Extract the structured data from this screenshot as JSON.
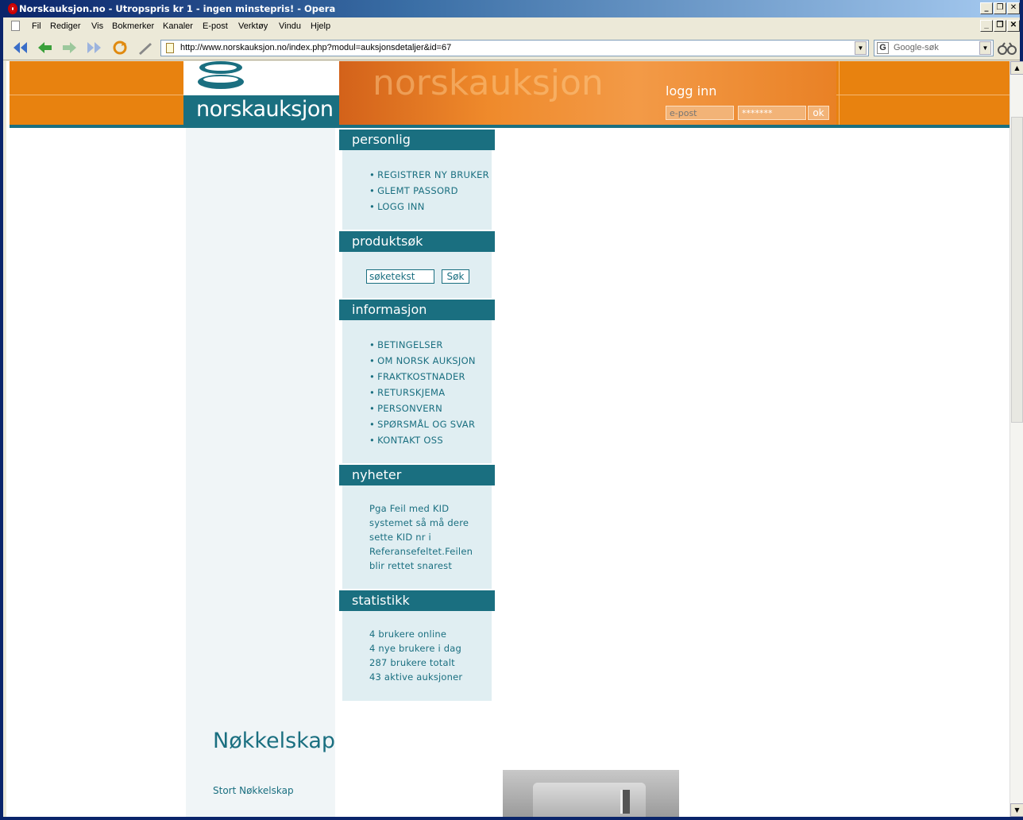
{
  "browser": {
    "title": "Norskauksjon.no - Utropspris kr 1 - ingen minstepris! - Opera",
    "menu": [
      "Fil",
      "Rediger",
      "Vis",
      "Bokmerker",
      "Kanaler",
      "E-post",
      "Verktøy",
      "Vindu",
      "Hjelp"
    ],
    "url": "http://www.norskauksjon.no/index.php?modul=auksjonsdetaljer&id=67",
    "search_placeholder": "Google-søk"
  },
  "site": {
    "logo_text": "norskauksjon",
    "banner_ghost": "norskauksjon",
    "login": {
      "title": "logg inn",
      "email_placeholder": "e-post",
      "password_value": "*******",
      "ok_label": "ok"
    },
    "personlig": {
      "heading": "personlig",
      "links": [
        "REGISTRER NY BRUKER",
        "GLEMT PASSORD",
        "LOGG INN"
      ]
    },
    "produktsok": {
      "heading": "produktsøk",
      "input_value": "søketekst",
      "button": "Søk"
    },
    "informasjon": {
      "heading": "informasjon",
      "links": [
        "BETINGELSER",
        "OM NORSK AUKSJON",
        "FRAKTKOSTNADER",
        "RETURSKJEMA",
        "PERSONVERN",
        "SPØRSMÅL OG SVAR",
        "KONTAKT OSS"
      ]
    },
    "nyheter": {
      "heading": "nyheter",
      "lines": [
        "Pga Feil med KID",
        "systemet så må dere",
        "sette KID nr i",
        "Referansefeltet.Feilen",
        "blir rettet snarest"
      ]
    },
    "statistikk": {
      "heading": "statistikk",
      "lines": [
        "4 brukere online",
        "4 nye brukere i dag",
        "287 brukere totalt",
        "43 aktive auksjoner"
      ]
    },
    "product": {
      "title": "Nøkkelskap",
      "subtitle": "Stort Nøkkelskap"
    }
  },
  "colors": {
    "orange": "#e8820f",
    "teal": "#1a6f80",
    "panel": "#e0eef2"
  }
}
